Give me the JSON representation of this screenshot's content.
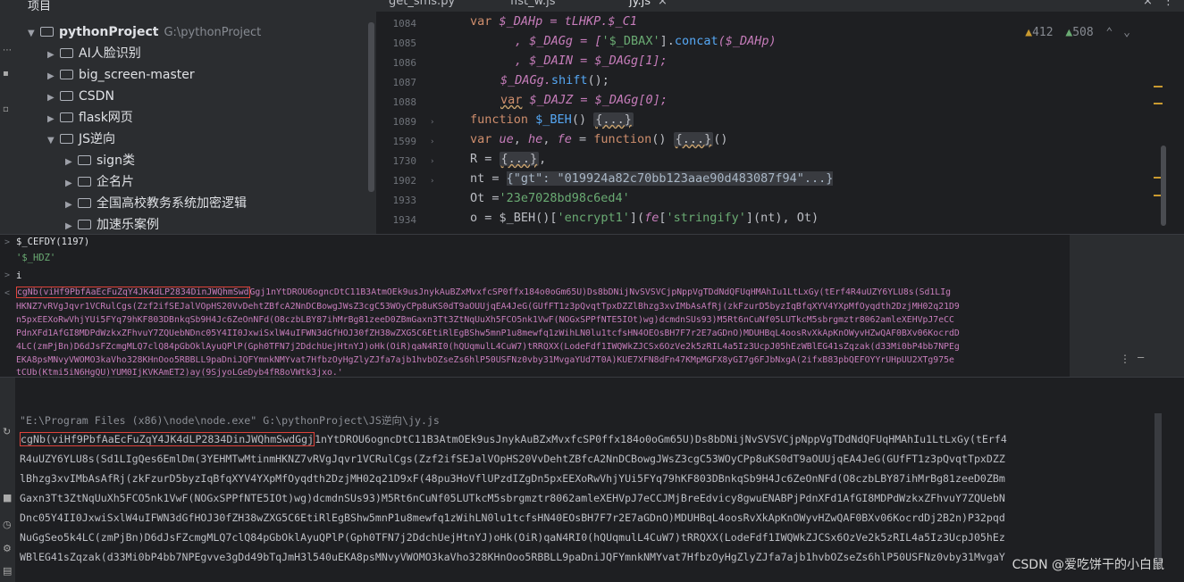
{
  "project": {
    "header": "项目",
    "root_name": "pythonProject",
    "root_path": "G:\\pythonProject",
    "items": [
      "AI人脸识别",
      "big_screen-master",
      "CSDN",
      "flask网页",
      "JS逆向",
      "sign类",
      "企名片",
      "全国高校教务系统加密逻辑",
      "加速乐案例"
    ]
  },
  "tabs": [
    "get_sms.py",
    "fist_w.js",
    "jy.js"
  ],
  "inspect": {
    "warnings": "412",
    "weak": "508"
  },
  "editor": {
    "line_numbers": [
      "1084",
      "1085",
      "1086",
      "1087",
      "1088",
      "1089",
      "1599",
      "1730",
      "1902",
      "1933",
      "1934"
    ],
    "l1084": [
      "var",
      " $_DAHp = tLHKP.$_C1"
    ],
    "l1085_a": ", $_DAGg = [",
    "l1085_s": "'$_DBAX'",
    "l1085_b": "].",
    "l1085_f": "concat",
    "l1085_c": "($_DAHp)",
    "l1086": ", $_DAIN = $_DAGg[1];",
    "l1087_a": "$_DAGg.",
    "l1087_f": "shift",
    "l1087_b": "();",
    "l1088_k": "var",
    "l1088_b": " $_DAJZ = $_DAGg[0];",
    "l1089_k": "function",
    "l1089_f": " $_BEH",
    "l1089_b": "() ",
    "l1089_box": "{...}",
    "l1599_k": "var",
    "l1599_v1": " ue",
    "l1599_v2": "he",
    "l1599_v3": "fe",
    "l1599_eq": " = ",
    "l1599_k2": "function",
    "l1599_b": "() ",
    "l1599_box": "{...}",
    "l1599_c": "()",
    "l1730_a": "R = ",
    "l1730_box": "{...}",
    "l1730_c": ",",
    "l1902_a": "nt = ",
    "l1902_hint": "{\"gt\": \"019924a82c70bb123aae90d483087f94\"...}",
    "l1933_a": "Ot =",
    "l1933_s": "'23e7028bd98c6ed4'",
    "l1934_a": "o = $_BEH()[",
    "l1934_s": "'encrypt1'",
    "l1934_b": "](",
    "l1934_v": "fe",
    "l1934_c": "[",
    "l1934_s2": "'stringify'",
    "l1934_d": "](nt), Ot)"
  },
  "console": {
    "line1": "$_CEFDY(1197)",
    "line2": "'$_HDZ'",
    "line3": "i",
    "out_boxed": "cgNb(viHf9PbfAaEcFuZqY4JK4dLP2834DinJWQhmSwd",
    "out_first_rest": "Ggj1nYtDROU6ogncDtC11B3AtmOEk9usJnykAuBZxMvxfcSP0ffx184o0oGm65U)Ds8bDNijNvSVSVCjpNppVgTDdNdQFUqHMAhIu1LtLxGy(tErf4R4uUZY6YLU8s(Sd1LIg",
    "out_lines": [
      "HKNZ7vRVgJqvr1VCRulCgs(Zzf2ifSEJalVOpHS20VvDehtZBfcA2NnDCBowgJWsZ3cgC53WOyCPp8uKS0dT9aOUUjqEA4JeG(GUfFT1z3pQvqtTpxDZZlBhzg3xvIMbAsAfRj(zkFzurD5byzIqBfqXYV4YXpMfOyqdth2DzjMH02q21D9",
      "n5pxEEXoRwVhjYUi5FYq79hKF803DBnkqSb9H4Jc6ZeOnNFd(O8czbLBY87ihMrBg81zeeD0ZBmGaxn3Tt3ZtNqUuXh5FCO5nk1VwF(NOGxSPPfNTE5IOt)wg)dcmdnSUs93)M5Rt6nCuNf05LUTkcM5sbrgmztr8062amleXEHVpJ7eCC",
      "PdnXFd1AfGI8MDPdWzkxZFhvuY7ZQUebNDnc05Y4II0JxwiSxlW4uIFWN3dGfHOJ30fZH38wZXG5C6EtiRlEgBShw5mnP1u8mewfq1zWihLN0lu1tcfsHN4OEOsBH7F7r2E7aGDnO)MDUHBqL4oosRvXkApKnOWyvHZwQAF0BXv06KocrdD",
      "4LC(zmPjBn)D6dJsFZcmgMLQ7clQ84pGbOklAyuQPlP(Gph0TFN7j2DdchUejHtnYJ)oHk(OiR)qaN4RI0(hQUqmulL4CuW7)tRRQXX(LodeFdf1IWQWkZJCSx6OzVe2k5zRIL4a5Iz3UcpJ05hEzWBlEG41sZqzak(d33Mi0bP4bb7NPEg",
      "EKA8psMNvyVWOMO3kaVho328KHnOoo5RBBLL9paDniJQFYmnkNMYvat7HfbzOyHgZlyZJfa7ajb1hvbOZseZs6hlP50USFNz0vby31MvgaYUd7T0A)KUE7XFN8dFn47KMpMGFX8yGI7g6FJbNxgA(2ifxB83pbQEFOYYrUHpUU2XTg975e",
      "tCUb(Ktmi5iN6HgQU)YUM0IjKVKAmET2)ay(9SjyoLGeDyb4fR8oVWtk3jxo.'"
    ]
  },
  "terminal": {
    "cmd": "\"E:\\Program Files (x86)\\node\\node.exe\" G:\\pythonProject\\JS逆向\\jy.js",
    "out_boxed": "cgNb(viHf9PbfAaEcFuZqY4JK4dLP2834DinJWQhmSwdGgj",
    "out_first_rest": "1nYtDROU6ogncDtC11B3AtmOEk9usJnykAuBZxMvxfcSP0ffx184o0oGm65U)Ds8bDNijNvSVSVCjpNppVgTDdNdQFUqHMAhIu1LtLxGy(tErf4",
    "out_lines": [
      "R4uUZY6YLU8s(Sd1LIgQes6EmlDm(3YEHMTwMtinmHKNZ7vRVgJqvr1VCRulCgs(Zzf2ifSEJalVOpHS20VvDehtZBfcA2NnDCBowgJWsZ3cgC53WOyCPp8uKS0dT9aOUUjqEA4JeG(GUfFT1z3pQvqtTpxDZZ",
      "lBhzg3xvIMbAsAfRj(zkFzurD5byzIqBfqXYV4YXpMfOyqdth2DzjMH02q21D9xF(48pu3HoVflUPzdIZgDn5pxEEXoRwVhjYUi5FYq79hKF803DBnkqSb9H4Jc6ZeOnNFd(O8czbLBY87ihMrBg81zeeD0ZBm",
      "Gaxn3Tt3ZtNqUuXh5FCO5nk1VwF(NOGxSPPfNTE5IOt)wg)dcmdnSUs93)M5Rt6nCuNf05LUTkcM5sbrgmztr8062amleXEHVpJ7eCCJMjBreEdvicy8gwuENABPjPdnXFd1AfGI8MDPdWzkxZFhvuY7ZQUebN",
      "Dnc05Y4II0JxwiSxlW4uIFWN3dGfHOJ30fZH38wZXG5C6EtiRlEgBShw5mnP1u8mewfq1zWihLN0lu1tcfsHN40EOsBH7F7r2E7aGDnO)MDUHBqL4oosRvXkApKnOWyvHZwQAF0BXv06KocrdDj2B2n)P32pqd",
      "NuGgSeo5k4LC(zmPjBn)D6dJsFZcmgMLQ7clQ84pGbOklAyuQPlP(Gph0TFN7j2DdchUejHtnYJ)oHk(OiR)qaN4RI0(hQUqmulL4CuW7)tRRQXX(LodeFdf1IWQWkZJCSx6OzVe2k5zRIL4a5Iz3UcpJ05hEz",
      "WBlEG41sZqzak(d33Mi0bP4bb7NPEgvve3gDd49bTqJmH3l540uEKA8psMNvyVWOMO3kaVho328KHnOoo5RBBLL9paDniJQFYmnkNMYvat7HfbzOyHgZlyZJfa7ajb1hvbOZseZs6hlP50USFNz0vby31MvgaY"
    ]
  },
  "watermark": "CSDN @爱吃饼干的小白鼠"
}
